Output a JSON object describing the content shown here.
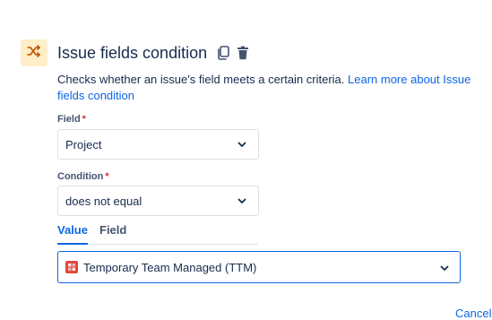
{
  "header": {
    "title": "Issue fields condition",
    "icon": "shuffle-icon",
    "actions": [
      {
        "name": "copy-icon"
      },
      {
        "name": "trash-icon"
      }
    ]
  },
  "description": {
    "text": "Checks whether an issue's field meets a certain criteria. ",
    "link_text": "Learn more about Issue fields condition"
  },
  "field": {
    "label": "Field",
    "required_marker": "*",
    "value": "Project"
  },
  "condition": {
    "label": "Condition",
    "required_marker": "*",
    "value": "does not equal"
  },
  "tabs": [
    {
      "label": "Value",
      "active": true
    },
    {
      "label": "Field",
      "active": false
    }
  ],
  "value_select": {
    "value": "Temporary Team Managed (TTM)",
    "avatar_color": "#e2483d"
  },
  "footer": {
    "cancel_label": "Cancel"
  },
  "colors": {
    "accent": "#0c66e4",
    "icon_tile_bg": "#ffefc9",
    "icon_tile_fg": "#c25100",
    "required": "#c9372c"
  }
}
